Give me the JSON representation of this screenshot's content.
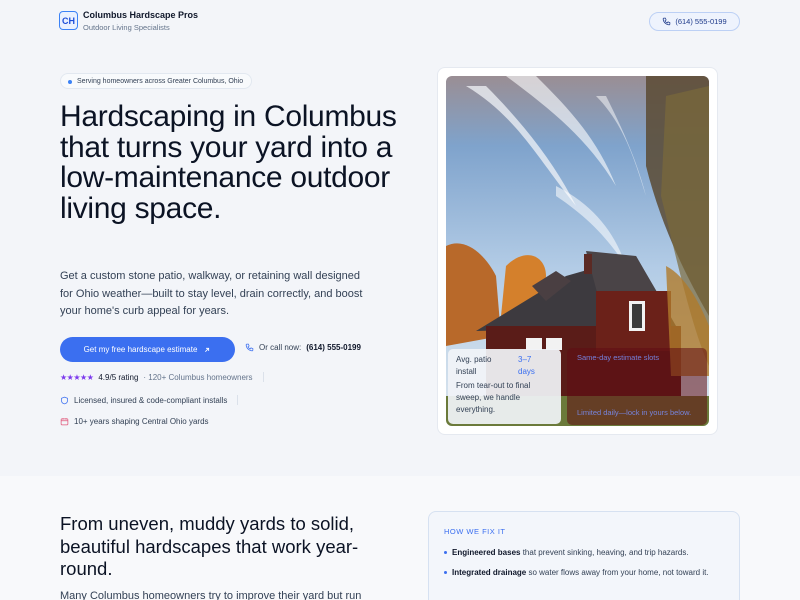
{
  "header": {
    "logo_initials": "CH",
    "brand_name": "Columbus Hardscape Pros",
    "tagline": "Outdoor Living Specialists",
    "phone": "(614) 555-0199",
    "phone_icon": "phone-icon"
  },
  "hero": {
    "pill": "Serving homeowners across Greater Columbus, Ohio",
    "title": "Hardscaping in Columbus that turns your yard into a low-maintenance outdoor living space.",
    "subtitle": "Get a custom stone patio, walkway, or retaining wall designed for Ohio weather—built to stay level, drain correctly, and boost your home's curb appeal for years.",
    "cta_label": "Get my free hardscape estimate",
    "call_prefix": "Or call now:",
    "call_number": "(614) 555-0199",
    "rating_stars": "★★★★★",
    "rating": "4.9/5 rating",
    "rating_count": "· 120+ Columbus homeowners",
    "trust_1": "Licensed, insured & code-compliant installs",
    "trust_2": "10+ years shaping Central Ohio yards"
  },
  "photo": {
    "stat_label": "Avg. patio install",
    "stat_value": "3–7 days",
    "stat_desc": "From tear-out to final sweep, we handle everything.",
    "estimate_title": "Same-day estimate slots",
    "estimate_note": "Limited daily—lock in yours below."
  },
  "section2": {
    "title": "From uneven, muddy yards to solid, beautiful hardscapes that work year-round.",
    "para": "Many Columbus homeowners try to improve their yard but run",
    "fix_title": "HOW WE FIX IT",
    "fix_items": [
      {
        "bold": "Engineered bases",
        "rest": " that prevent sinking, heaving, and trip hazards."
      },
      {
        "bold": "Integrated drainage",
        "rest": " so water flows away from your home, not toward it."
      }
    ]
  },
  "colors": {
    "accent": "#3b6ff0",
    "star": "#7c3aed"
  }
}
